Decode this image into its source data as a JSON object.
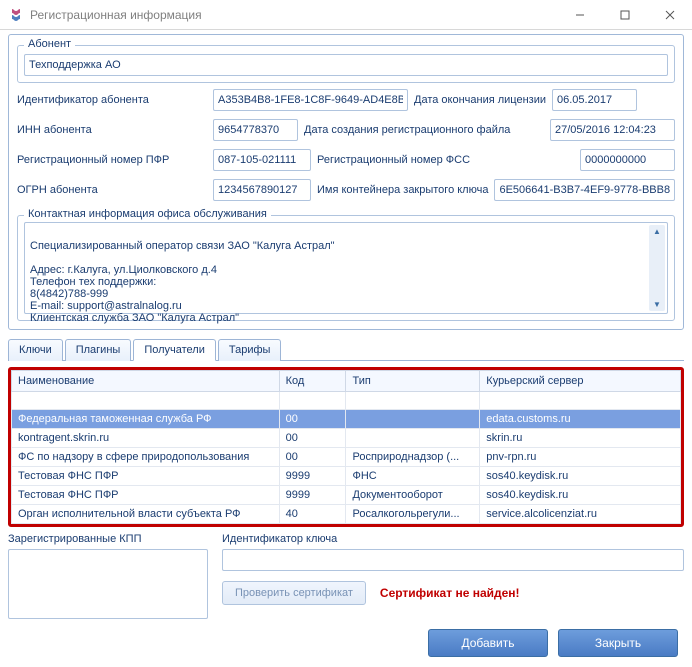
{
  "window": {
    "title": "Регистрационная информация"
  },
  "groups": {
    "subscriber": "Абонент",
    "contact": "Контактная информация офиса обслуживания"
  },
  "subscriber_name": "Техподдержка АО",
  "labels": {
    "identifier": "Идентификатор абонента",
    "license_end": "Дата окончания лицензии",
    "inn": "ИНН абонента",
    "reg_file_date": "Дата создания регистрационного файла",
    "pfr_num": "Регистрационный номер ПФР",
    "fss_num": "Регистрационный номер ФСС",
    "ogrn": "ОГРН абонента",
    "container": "Имя контейнера закрытого ключа"
  },
  "values": {
    "identifier": "A353B4B8-1FE8-1C8F-9649-AD4E8B",
    "license_end": "06.05.2017",
    "inn": "9654778370",
    "reg_file_date": "27/05/2016 12:04:23",
    "pfr_num": "087-105-021111",
    "fss_num": "0000000000",
    "ogrn": "1234567890127",
    "container": "6E506641-B3B7-4EF9-9778-BBB8"
  },
  "contact_info": "Специализированный оператор связи ЗАО \"Калуга Астрал\"\n\n  Адрес: г.Калуга, ул.Циолковского д.4\n  Телефон тех поддержки:\n  8(4842)788-999\n  E-mail: support@astralnalog.ru\n  Клиентская служба ЗАО \"Калуга Астрал\"",
  "tabs": {
    "keys": "Ключи",
    "plugins": "Плагины",
    "recipients": "Получатели",
    "tariffs": "Тарифы"
  },
  "table": {
    "headers": {
      "name": "Наименование",
      "code": "Код",
      "type": "Тип",
      "server": "Курьерский сервер"
    },
    "rows": [
      {
        "name": "Федеральная таможенная служба РФ",
        "code": "00",
        "type": "",
        "server": "edata.customs.ru",
        "selected": true
      },
      {
        "name": "kontragent.skrin.ru",
        "code": "00",
        "type": "",
        "server": "skrin.ru"
      },
      {
        "name": "ФС по надзору в сфере природопользования",
        "code": "00",
        "type": "Росприроднадзор (...",
        "server": "pnv-rpn.ru"
      },
      {
        "name": "Тестовая ФНС ПФР",
        "code": "9999",
        "type": "ФНС",
        "server": "sos40.keydisk.ru"
      },
      {
        "name": "Тестовая ФНС ПФР",
        "code": "9999",
        "type": "Документооборот",
        "server": "sos40.keydisk.ru"
      },
      {
        "name": "Орган исполнительной власти субъекта РФ",
        "code": "40",
        "type": "Росалкогольрегули...",
        "server": "service.alcolicenziat.ru"
      }
    ]
  },
  "sub": {
    "kpp_label": "Зарегистрированные КПП",
    "key_id_label": "Идентификатор ключа",
    "check_cert": "Проверить сертификат",
    "cert_status": "Сертификат не найден!"
  },
  "footer": {
    "add": "Добавить",
    "close": "Закрыть"
  }
}
